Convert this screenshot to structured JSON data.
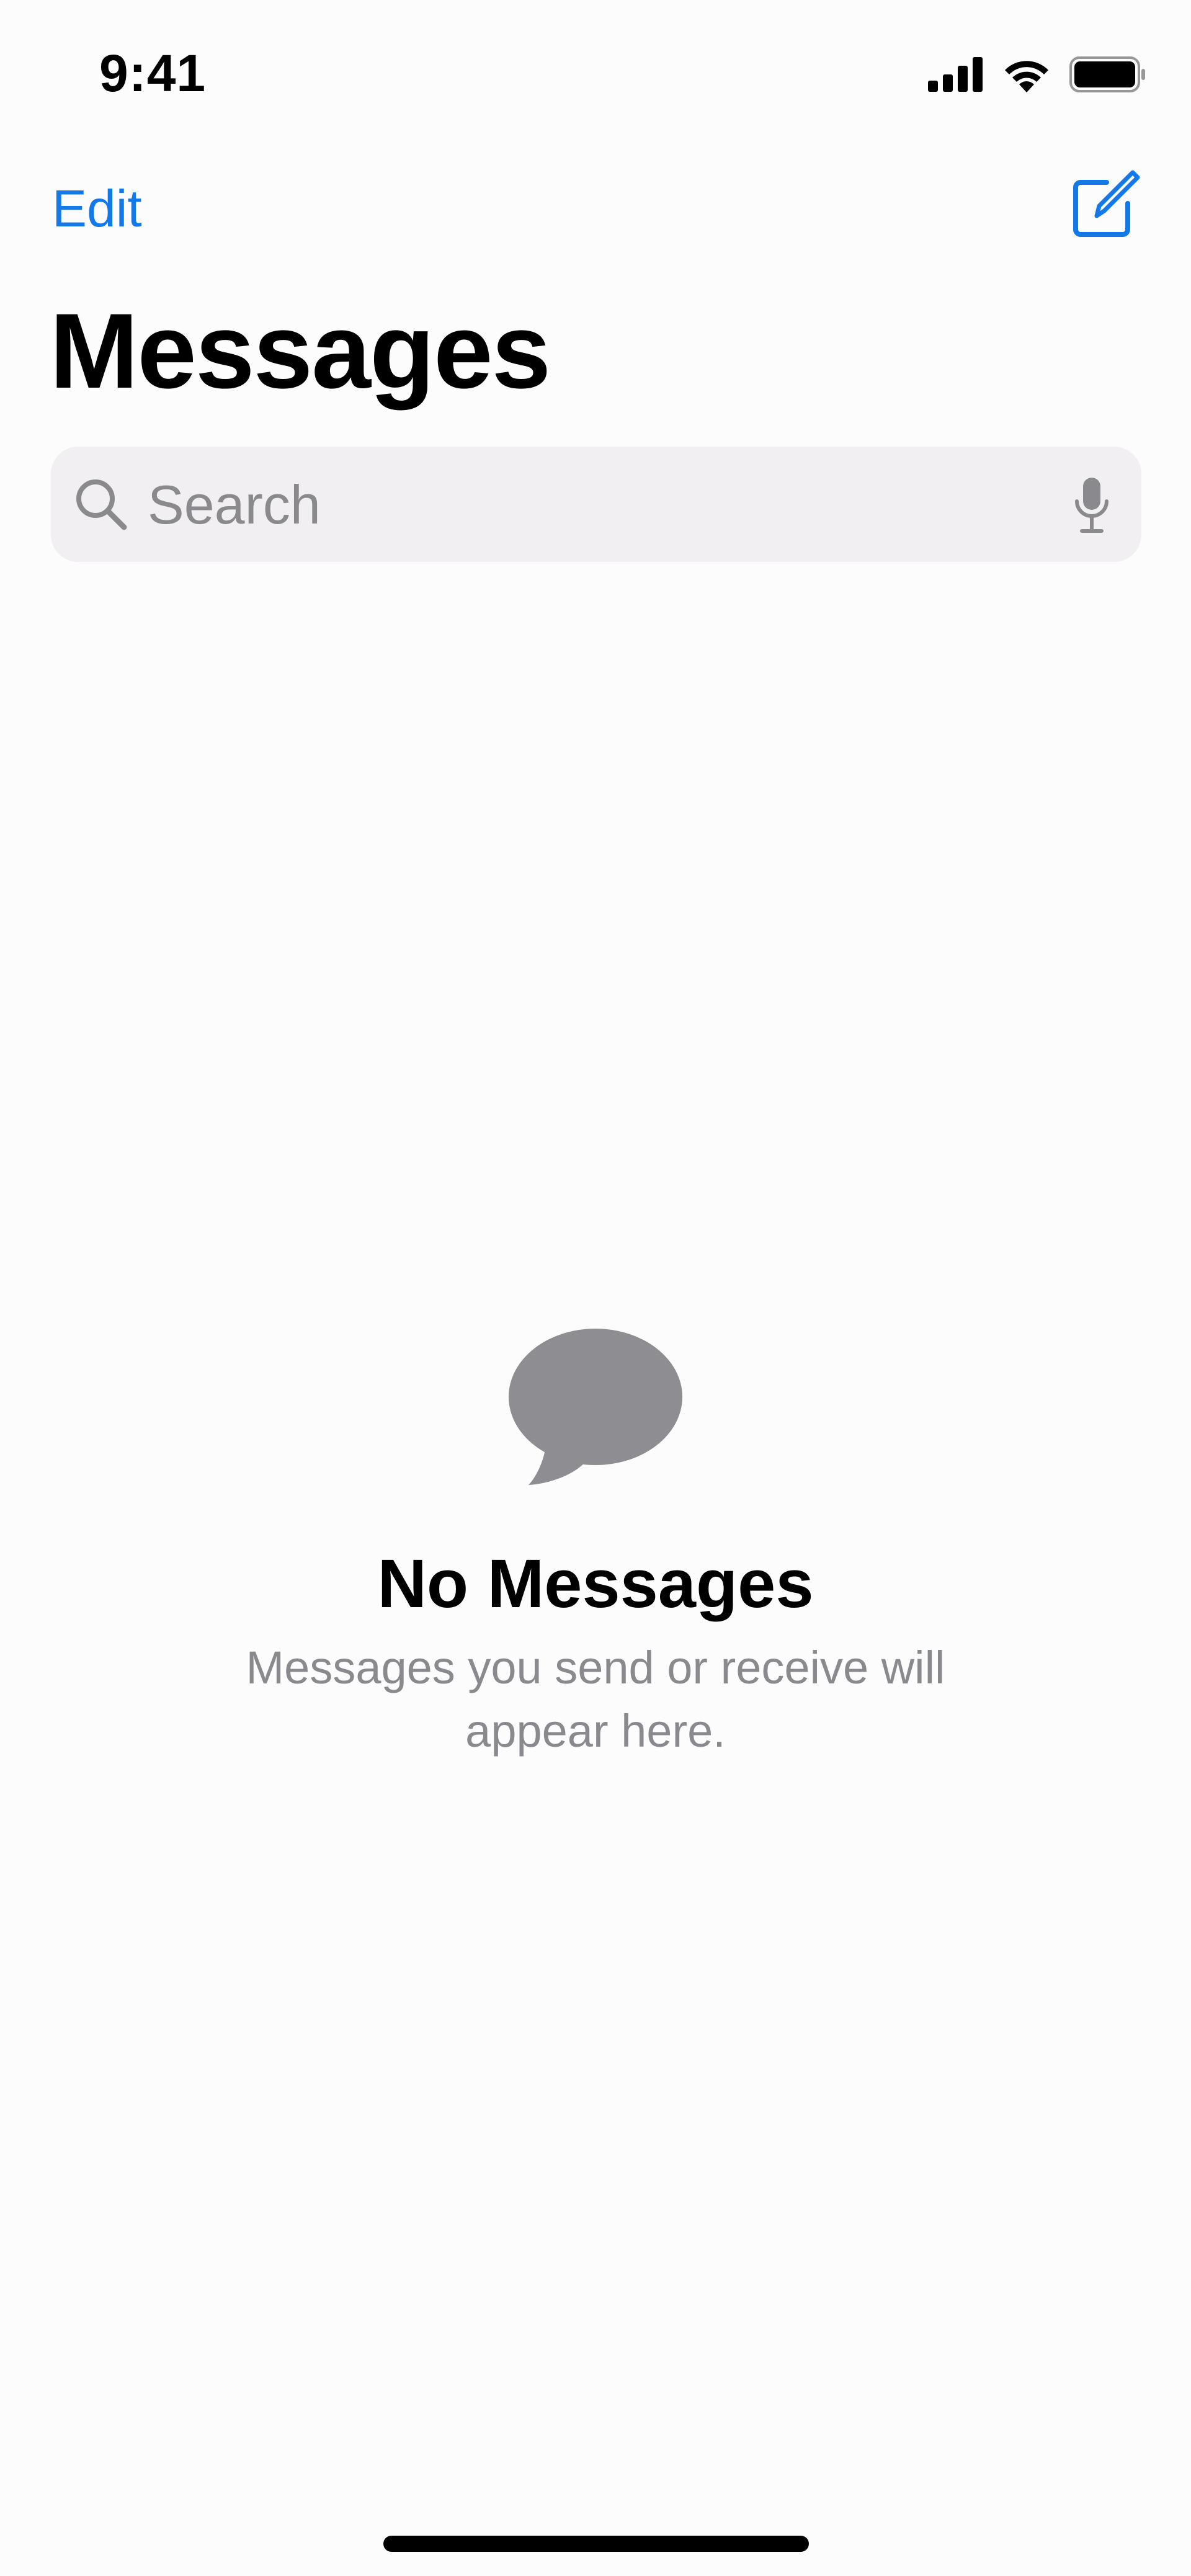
{
  "status_bar": {
    "time": "9:41"
  },
  "nav": {
    "edit_label": "Edit",
    "compose_icon": "compose-icon",
    "title": "Messages"
  },
  "search": {
    "placeholder": "Search",
    "value": ""
  },
  "empty_state": {
    "icon": "message-bubble-icon",
    "title": "No Messages",
    "subtitle": "Messages you send or receive will appear here."
  },
  "colors": {
    "accent": "#1479e8",
    "background": "#fdfcfd",
    "search_background": "#f1eff1",
    "secondary_text": "#8a898e",
    "empty_icon": "#8e8d92"
  }
}
